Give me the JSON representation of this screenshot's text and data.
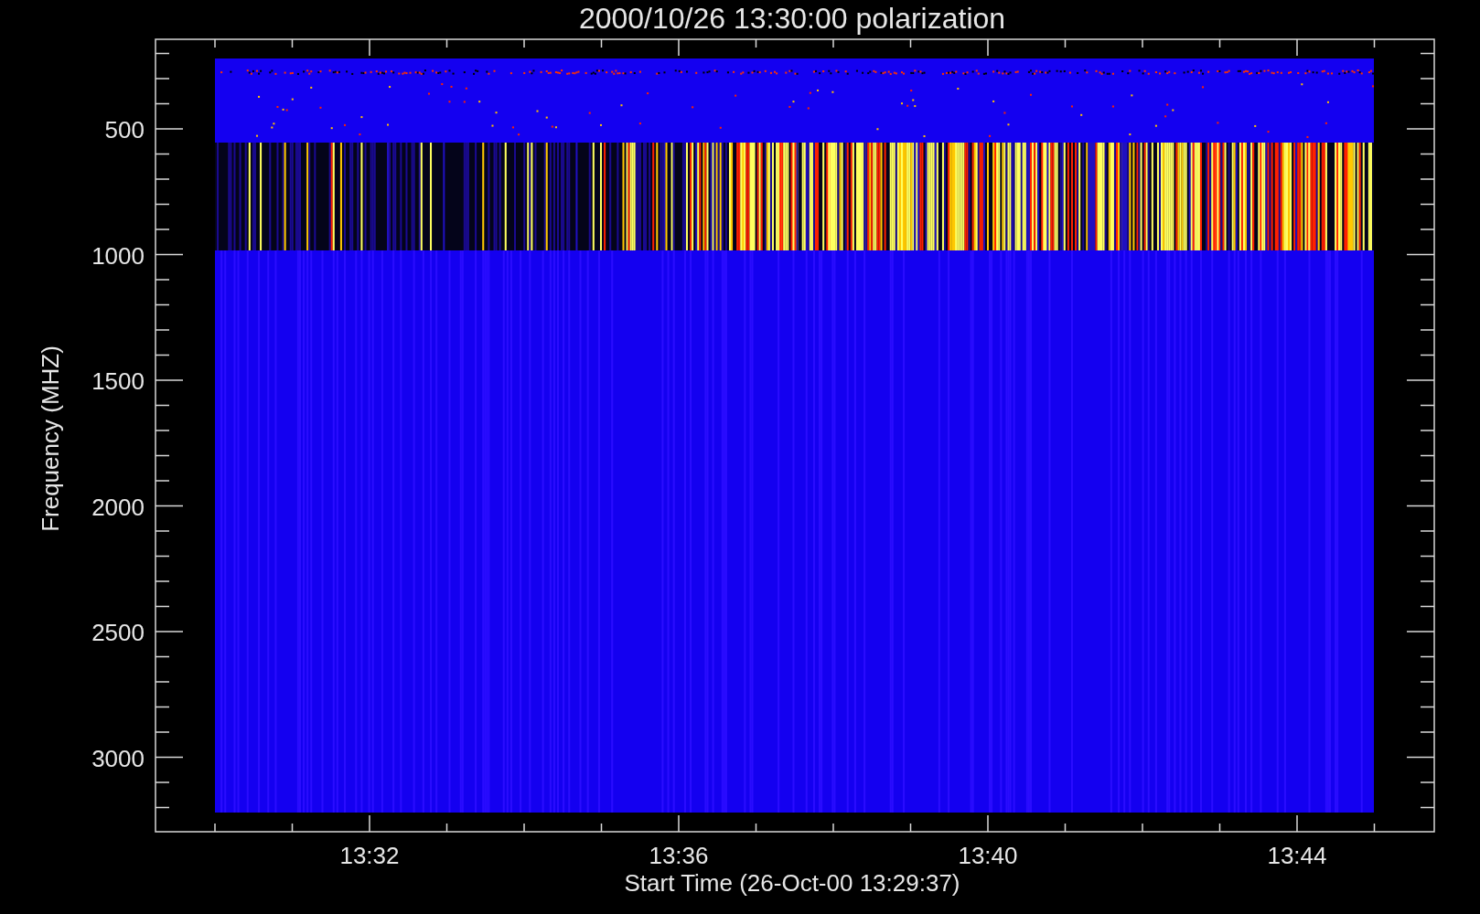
{
  "title": "2000/10/26 13:30:00 polarization",
  "y_axis": {
    "label": "Frequency (MHZ)",
    "ticks": [
      "500",
      "1000",
      "1500",
      "2000",
      "2500",
      "3000"
    ]
  },
  "x_axis": {
    "label": "Start Time (26-Oct-00 13:29:37)",
    "ticks": [
      "13:32",
      "13:36",
      "13:40",
      "13:44"
    ]
  }
}
